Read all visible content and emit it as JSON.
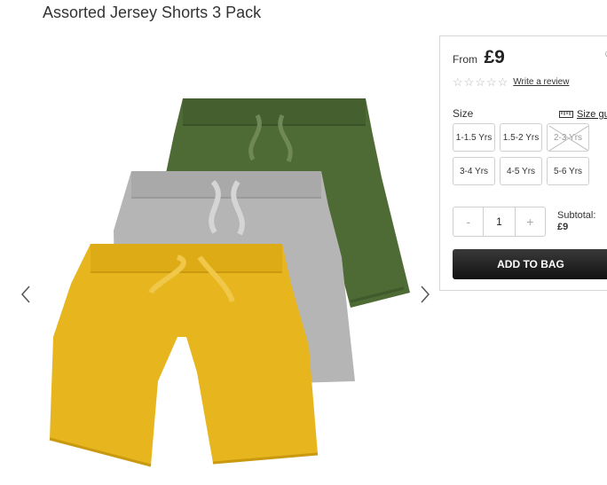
{
  "product": {
    "title": "Assorted Jersey Shorts 3 Pack",
    "price_prefix": "From",
    "price": "£9",
    "wishlist_icon": "heart-icon",
    "rating": {
      "stars_filled": 0,
      "stars_total": 5,
      "review_link": "Write a review"
    },
    "size_label": "Size",
    "size_guide_label": "Size guide",
    "sizes": [
      {
        "label": "1-1.5 Yrs",
        "available": true
      },
      {
        "label": "1.5-2 Yrs",
        "available": true
      },
      {
        "label": "2-3 Yrs",
        "available": false
      },
      {
        "label": "3-4 Yrs",
        "available": true
      },
      {
        "label": "4-5 Yrs",
        "available": true
      },
      {
        "label": "5-6 Yrs",
        "available": true
      }
    ],
    "quantity": {
      "minus": "-",
      "value": "1",
      "plus": "+"
    },
    "subtotal_label": "Subtotal:",
    "subtotal_value": "£9",
    "add_to_bag": "ADD TO BAG"
  },
  "gallery": {
    "prev_icon": "chevron-left-icon",
    "next_icon": "chevron-right-icon",
    "colors": {
      "green": "#4e6a35",
      "grey": "#b5b5b5",
      "yellow": "#e7b51d"
    }
  }
}
